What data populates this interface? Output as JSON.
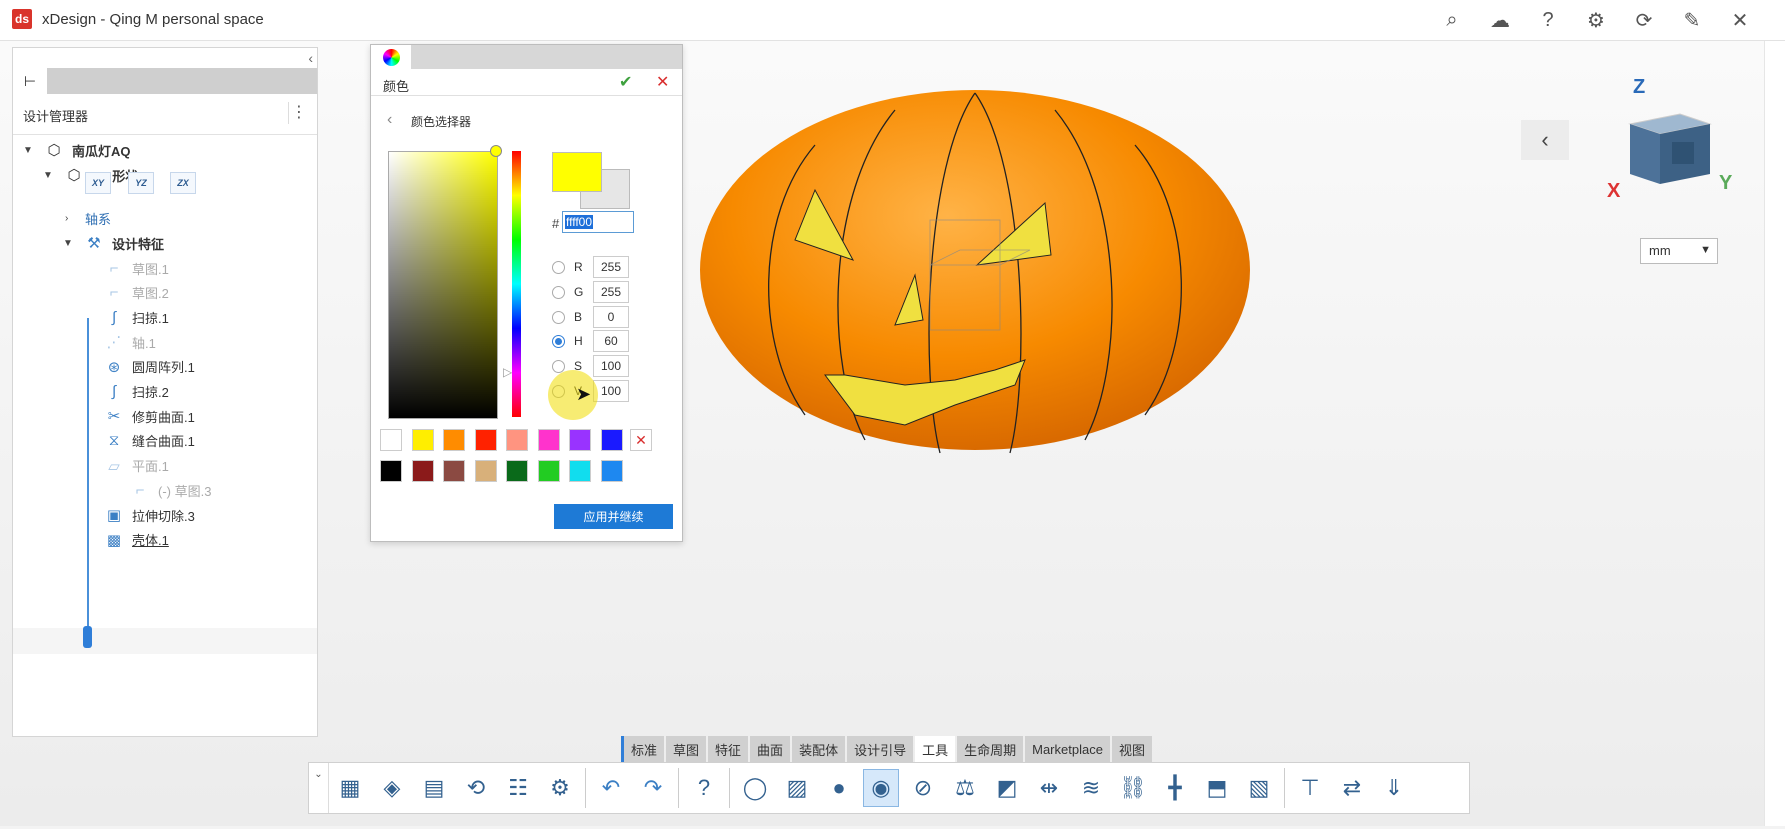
{
  "app": {
    "title": "xDesign - Qing M personal space",
    "logo_text": "ds"
  },
  "top_icons": [
    {
      "name": "search-icon",
      "glyph": "⌕"
    },
    {
      "name": "cloud-icon",
      "glyph": "☁"
    },
    {
      "name": "help-icon",
      "glyph": "?"
    },
    {
      "name": "gear-icon",
      "glyph": "⚙"
    },
    {
      "name": "refresh-icon",
      "glyph": "⟳"
    },
    {
      "name": "pin-icon",
      "glyph": "✎"
    },
    {
      "name": "close-icon",
      "glyph": "✕"
    }
  ],
  "design_manager": {
    "title": "设计管理器",
    "tree": {
      "root": "南瓜灯AQ",
      "shape": "3D 形状",
      "planes": [
        "XY",
        "YZ",
        "ZX"
      ],
      "axes": "轴系",
      "features": "设计特征",
      "items": [
        {
          "label": "草图.1",
          "state": "dim",
          "icon": "⌐"
        },
        {
          "label": "草图.2",
          "state": "dim",
          "icon": "⌐"
        },
        {
          "label": "扫掠.1",
          "state": "normal",
          "icon": "∫"
        },
        {
          "label": "轴.1",
          "state": "dim",
          "icon": "⋰"
        },
        {
          "label": "圆周阵列.1",
          "state": "normal",
          "icon": "⊛"
        },
        {
          "label": "扫掠.2",
          "state": "normal",
          "icon": "∫"
        },
        {
          "label": "修剪曲面.1",
          "state": "normal",
          "icon": "✂"
        },
        {
          "label": "缝合曲面.1",
          "state": "normal",
          "icon": "⧖"
        },
        {
          "label": "平面.1",
          "state": "dim",
          "icon": "▱"
        },
        {
          "label": "(-)  草图.3",
          "state": "dim",
          "icon": "⌐"
        },
        {
          "label": "拉伸切除.3",
          "state": "normal",
          "icon": "▣"
        },
        {
          "label": "壳体.1",
          "state": "normal",
          "icon": "▩"
        }
      ]
    }
  },
  "color_dialog": {
    "title": "颜色",
    "subtitle": "颜色选择器",
    "hex_value": "ffff00",
    "hex_hash": "#",
    "channels": [
      {
        "label": "R",
        "value": "255",
        "selected": false
      },
      {
        "label": "G",
        "value": "255",
        "selected": false
      },
      {
        "label": "B",
        "value": "0",
        "selected": false
      },
      {
        "label": "H",
        "value": "60",
        "selected": true
      },
      {
        "label": "S",
        "value": "100",
        "selected": false
      },
      {
        "label": "V",
        "value": "100",
        "selected": false
      }
    ],
    "swatches_row1": [
      "#ffffff",
      "#ffee00",
      "#ff8c00",
      "#ff2200",
      "#ff9480",
      "#ff33cc",
      "#9933ff",
      "#1a1aff"
    ],
    "swatches_row2": [
      "#000000",
      "#8b1a1a",
      "#8b4a42",
      "#d8b07a",
      "#0a6a1a",
      "#22cc22",
      "#11ddee",
      "#1e88f0"
    ],
    "new_color": "#ffff00",
    "apply_label": "应用并继续"
  },
  "viewport": {
    "unit": "mm",
    "axis_labels": {
      "z": "Z",
      "x": "X",
      "y": "Y"
    }
  },
  "command_tabs": [
    "标准",
    "草图",
    "特征",
    "曲面",
    "装配体",
    "设计引导",
    "工具",
    "生命周期",
    "Marketplace",
    "视图"
  ],
  "active_tab": "工具",
  "toolbar_buttons": [
    {
      "name": "new-part-icon",
      "glyph": "▦"
    },
    {
      "name": "open-icon",
      "glyph": "◈"
    },
    {
      "name": "save-icon",
      "glyph": "▤"
    },
    {
      "name": "rebuild-icon",
      "glyph": "⟲"
    },
    {
      "name": "properties-icon",
      "glyph": "☷"
    },
    {
      "name": "settings-icon",
      "glyph": "⚙"
    },
    {
      "name": "undo-icon",
      "glyph": "↶"
    },
    {
      "name": "redo-icon",
      "glyph": "↷"
    },
    {
      "name": "help-icon",
      "glyph": "?"
    },
    {
      "name": "lasso-icon",
      "glyph": "◯"
    },
    {
      "name": "image-icon",
      "glyph": "▨"
    },
    {
      "name": "appearance-icon",
      "glyph": "●"
    },
    {
      "name": "color-icon",
      "glyph": "◉"
    },
    {
      "name": "measure-icon",
      "glyph": "⊘"
    },
    {
      "name": "mass-properties-icon",
      "glyph": "⚖"
    },
    {
      "name": "section-icon",
      "glyph": "◩"
    },
    {
      "name": "clearance-icon",
      "glyph": "⇹"
    },
    {
      "name": "zebra-icon",
      "glyph": "≋"
    },
    {
      "name": "interference-icon",
      "glyph": "⛓"
    },
    {
      "name": "reference-axis-icon",
      "glyph": "╋"
    },
    {
      "name": "import-icon",
      "glyph": "⬒"
    },
    {
      "name": "snapshot-icon",
      "glyph": "▧"
    },
    {
      "name": "export-icon",
      "glyph": "⊤"
    },
    {
      "name": "compare-icon",
      "glyph": "⇄"
    },
    {
      "name": "dxf-export-icon",
      "glyph": "⇓"
    }
  ]
}
